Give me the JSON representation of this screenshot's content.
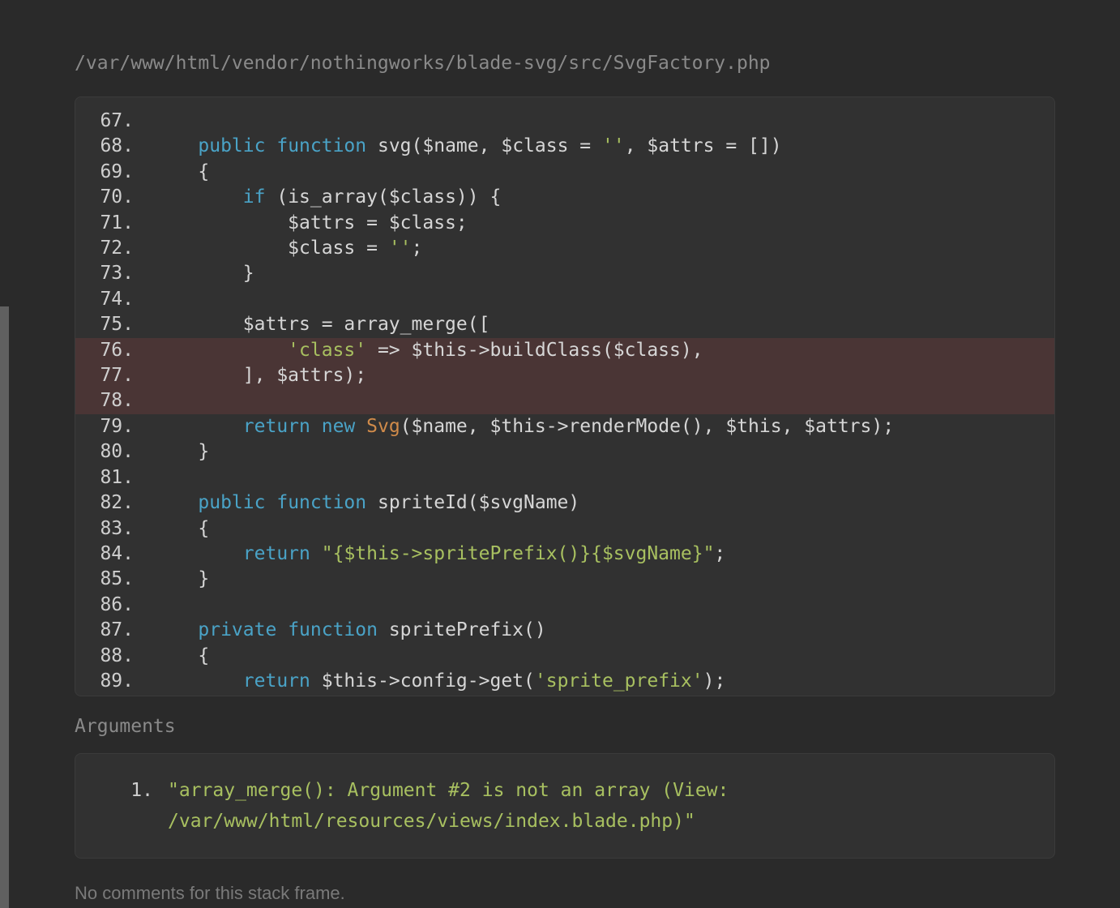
{
  "file_path": "/var/www/html/vendor/nothingworks/blade-svg/src/SvgFactory.php",
  "arguments_label": "Arguments",
  "no_comments": "No comments for this stack frame.",
  "arguments": [
    {
      "index": "1.",
      "lines": [
        "\"array_merge(): Argument #2 is not an array (View: ",
        "/var/www/html/resources/views/index.blade.php)\""
      ]
    }
  ],
  "highlighted_lines": [
    76,
    77,
    78
  ],
  "code_lines": [
    {
      "n": "67.",
      "tokens": []
    },
    {
      "n": "68.",
      "tokens": [
        {
          "t": "    ",
          "c": "code"
        },
        {
          "t": "public",
          "c": "tok-kw"
        },
        {
          "t": " ",
          "c": "code"
        },
        {
          "t": "function",
          "c": "tok-kw"
        },
        {
          "t": " ",
          "c": "code"
        },
        {
          "t": "svg",
          "c": "tok-fn"
        },
        {
          "t": "(",
          "c": "tok-punc"
        },
        {
          "t": "$name",
          "c": "tok-var"
        },
        {
          "t": ", ",
          "c": "tok-punc"
        },
        {
          "t": "$class",
          "c": "tok-var"
        },
        {
          "t": " = ",
          "c": "tok-op"
        },
        {
          "t": "''",
          "c": "tok-str"
        },
        {
          "t": ", ",
          "c": "tok-punc"
        },
        {
          "t": "$attrs",
          "c": "tok-var"
        },
        {
          "t": " = ",
          "c": "tok-op"
        },
        {
          "t": "[]",
          "c": "tok-punc"
        },
        {
          "t": ")",
          "c": "tok-punc"
        }
      ]
    },
    {
      "n": "69.",
      "tokens": [
        {
          "t": "    {",
          "c": "tok-punc"
        }
      ]
    },
    {
      "n": "70.",
      "tokens": [
        {
          "t": "        ",
          "c": "code"
        },
        {
          "t": "if",
          "c": "tok-kw"
        },
        {
          "t": " (",
          "c": "tok-punc"
        },
        {
          "t": "is_array",
          "c": "tok-fn"
        },
        {
          "t": "(",
          "c": "tok-punc"
        },
        {
          "t": "$class",
          "c": "tok-var"
        },
        {
          "t": ")) {",
          "c": "tok-punc"
        }
      ]
    },
    {
      "n": "71.",
      "tokens": [
        {
          "t": "            ",
          "c": "code"
        },
        {
          "t": "$attrs",
          "c": "tok-var"
        },
        {
          "t": " = ",
          "c": "tok-op"
        },
        {
          "t": "$class",
          "c": "tok-var"
        },
        {
          "t": ";",
          "c": "tok-punc"
        }
      ]
    },
    {
      "n": "72.",
      "tokens": [
        {
          "t": "            ",
          "c": "code"
        },
        {
          "t": "$class",
          "c": "tok-var"
        },
        {
          "t": " = ",
          "c": "tok-op"
        },
        {
          "t": "''",
          "c": "tok-str"
        },
        {
          "t": ";",
          "c": "tok-punc"
        }
      ]
    },
    {
      "n": "73.",
      "tokens": [
        {
          "t": "        }",
          "c": "tok-punc"
        }
      ]
    },
    {
      "n": "74.",
      "tokens": []
    },
    {
      "n": "75.",
      "tokens": [
        {
          "t": "        ",
          "c": "code"
        },
        {
          "t": "$attrs",
          "c": "tok-var"
        },
        {
          "t": " = ",
          "c": "tok-op"
        },
        {
          "t": "array_merge",
          "c": "tok-fn"
        },
        {
          "t": "([",
          "c": "tok-punc"
        }
      ]
    },
    {
      "n": "76.",
      "tokens": [
        {
          "t": "            ",
          "c": "code"
        },
        {
          "t": "'class'",
          "c": "tok-str"
        },
        {
          "t": " => ",
          "c": "tok-op"
        },
        {
          "t": "$this",
          "c": "tok-var"
        },
        {
          "t": "->",
          "c": "tok-op"
        },
        {
          "t": "buildClass",
          "c": "tok-fn"
        },
        {
          "t": "(",
          "c": "tok-punc"
        },
        {
          "t": "$class",
          "c": "tok-var"
        },
        {
          "t": "),",
          "c": "tok-punc"
        }
      ]
    },
    {
      "n": "77.",
      "tokens": [
        {
          "t": "        ], ",
          "c": "tok-punc"
        },
        {
          "t": "$attrs",
          "c": "tok-var"
        },
        {
          "t": ");",
          "c": "tok-punc"
        }
      ]
    },
    {
      "n": "78.",
      "tokens": []
    },
    {
      "n": "79.",
      "tokens": [
        {
          "t": "        ",
          "c": "code"
        },
        {
          "t": "return",
          "c": "tok-kw"
        },
        {
          "t": " ",
          "c": "code"
        },
        {
          "t": "new",
          "c": "tok-kw"
        },
        {
          "t": " ",
          "c": "code"
        },
        {
          "t": "Svg",
          "c": "tok-cls"
        },
        {
          "t": "(",
          "c": "tok-punc"
        },
        {
          "t": "$name",
          "c": "tok-var"
        },
        {
          "t": ", ",
          "c": "tok-punc"
        },
        {
          "t": "$this",
          "c": "tok-var"
        },
        {
          "t": "->",
          "c": "tok-op"
        },
        {
          "t": "renderMode",
          "c": "tok-fn"
        },
        {
          "t": "(), ",
          "c": "tok-punc"
        },
        {
          "t": "$this",
          "c": "tok-var"
        },
        {
          "t": ", ",
          "c": "tok-punc"
        },
        {
          "t": "$attrs",
          "c": "tok-var"
        },
        {
          "t": ");",
          "c": "tok-punc"
        }
      ]
    },
    {
      "n": "80.",
      "tokens": [
        {
          "t": "    }",
          "c": "tok-punc"
        }
      ]
    },
    {
      "n": "81.",
      "tokens": []
    },
    {
      "n": "82.",
      "tokens": [
        {
          "t": "    ",
          "c": "code"
        },
        {
          "t": "public",
          "c": "tok-kw"
        },
        {
          "t": " ",
          "c": "code"
        },
        {
          "t": "function",
          "c": "tok-kw"
        },
        {
          "t": " ",
          "c": "code"
        },
        {
          "t": "spriteId",
          "c": "tok-fn"
        },
        {
          "t": "(",
          "c": "tok-punc"
        },
        {
          "t": "$svgName",
          "c": "tok-var"
        },
        {
          "t": ")",
          "c": "tok-punc"
        }
      ]
    },
    {
      "n": "83.",
      "tokens": [
        {
          "t": "    {",
          "c": "tok-punc"
        }
      ]
    },
    {
      "n": "84.",
      "tokens": [
        {
          "t": "        ",
          "c": "code"
        },
        {
          "t": "return",
          "c": "tok-kw"
        },
        {
          "t": " ",
          "c": "code"
        },
        {
          "t": "\"{",
          "c": "tok-str"
        },
        {
          "t": "$this",
          "c": "tok-str"
        },
        {
          "t": "->spritePrefix()}{",
          "c": "tok-str"
        },
        {
          "t": "$svgName",
          "c": "tok-str"
        },
        {
          "t": "}\"",
          "c": "tok-str"
        },
        {
          "t": ";",
          "c": "tok-punc"
        }
      ]
    },
    {
      "n": "85.",
      "tokens": [
        {
          "t": "    }",
          "c": "tok-punc"
        }
      ]
    },
    {
      "n": "86.",
      "tokens": []
    },
    {
      "n": "87.",
      "tokens": [
        {
          "t": "    ",
          "c": "code"
        },
        {
          "t": "private",
          "c": "tok-kw"
        },
        {
          "t": " ",
          "c": "code"
        },
        {
          "t": "function",
          "c": "tok-kw"
        },
        {
          "t": " ",
          "c": "code"
        },
        {
          "t": "spritePrefix",
          "c": "tok-fn"
        },
        {
          "t": "()",
          "c": "tok-punc"
        }
      ]
    },
    {
      "n": "88.",
      "tokens": [
        {
          "t": "    {",
          "c": "tok-punc"
        }
      ]
    },
    {
      "n": "89.",
      "tokens": [
        {
          "t": "        ",
          "c": "code"
        },
        {
          "t": "return",
          "c": "tok-kw"
        },
        {
          "t": " ",
          "c": "code"
        },
        {
          "t": "$this",
          "c": "tok-var"
        },
        {
          "t": "->",
          "c": "tok-op"
        },
        {
          "t": "config",
          "c": "tok-fn"
        },
        {
          "t": "->",
          "c": "tok-op"
        },
        {
          "t": "get",
          "c": "tok-fn"
        },
        {
          "t": "(",
          "c": "tok-punc"
        },
        {
          "t": "'sprite_prefix'",
          "c": "tok-str"
        },
        {
          "t": ");",
          "c": "tok-punc"
        }
      ]
    }
  ]
}
